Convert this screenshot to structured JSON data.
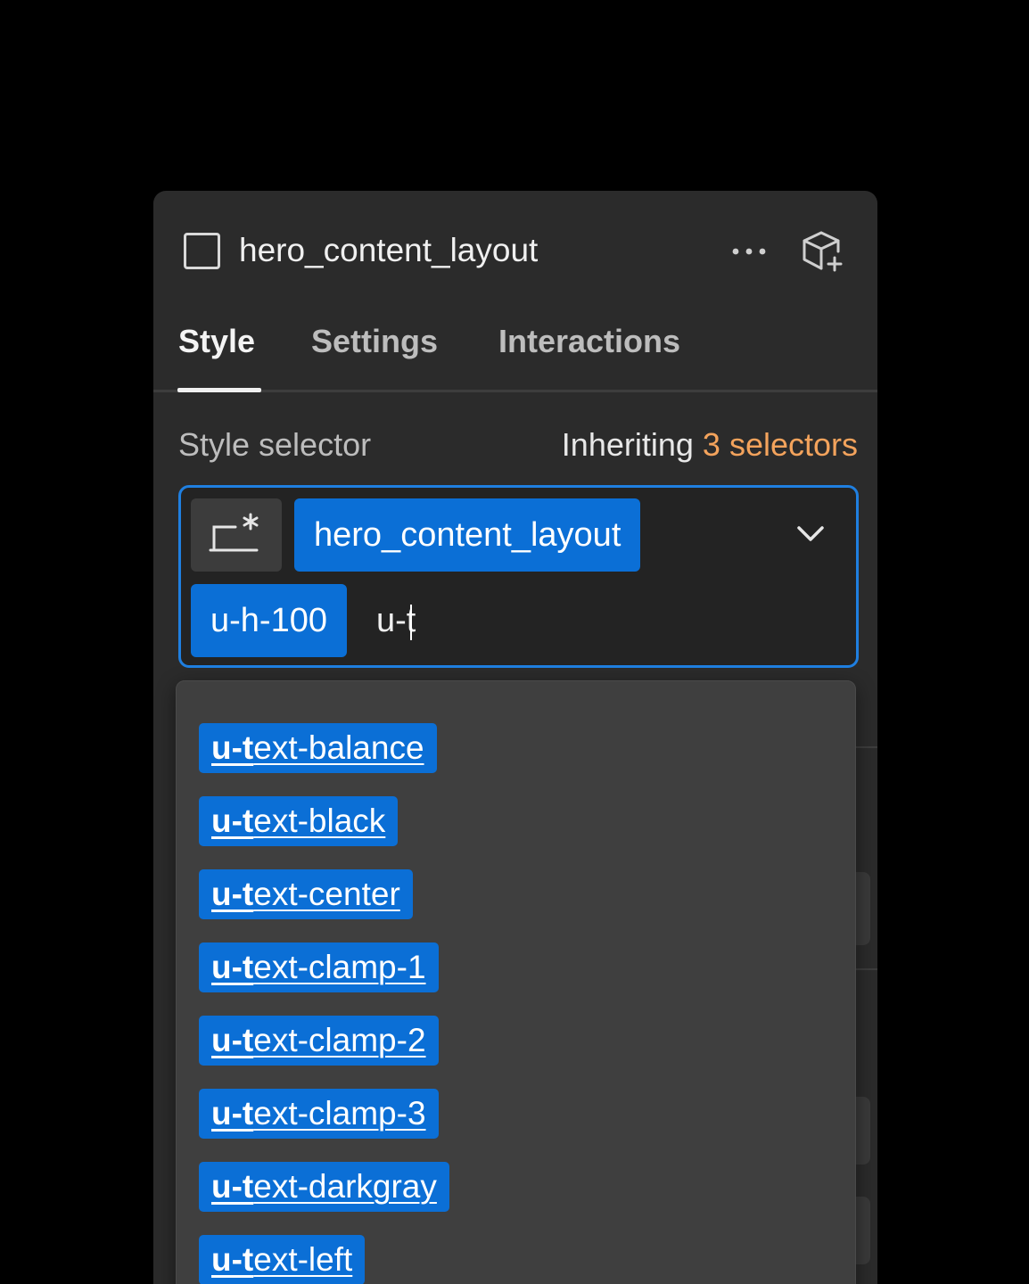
{
  "header": {
    "element_name": "hero_content_layout",
    "more_icon": "more-horizontal-icon",
    "add_component_icon": "cube-plus-icon"
  },
  "tabs": [
    {
      "label": "Style",
      "active": true
    },
    {
      "label": "Settings",
      "active": false
    },
    {
      "label": "Interactions",
      "active": false
    }
  ],
  "style_selector": {
    "label": "Style selector",
    "inheriting_prefix": "Inheriting",
    "inheriting_count": "3 selectors",
    "state_icon": "state-selector-icon",
    "chips": [
      "hero_content_layout",
      "u-h-100"
    ],
    "input_value": "u-t",
    "dropdown_icon": "chevron-down-icon"
  },
  "dropdown": {
    "match": "u-t",
    "options": [
      {
        "match": "u-t",
        "rest": "ext-balance"
      },
      {
        "match": "u-t",
        "rest": "ext-black"
      },
      {
        "match": "u-t",
        "rest": "ext-center"
      },
      {
        "match": "u-t",
        "rest": "ext-clamp-1"
      },
      {
        "match": "u-t",
        "rest": "ext-clamp-2"
      },
      {
        "match": "u-t",
        "rest": "ext-clamp-3"
      },
      {
        "match": "u-t",
        "rest": "ext-darkgray"
      },
      {
        "match": "u-t",
        "rest": "ext-left"
      }
    ]
  },
  "colors": {
    "accent_blue": "#0b6fd6",
    "focus_border": "#1f7fe0",
    "panel_bg": "#2b2b2b",
    "count_orange": "#f3a35c"
  }
}
